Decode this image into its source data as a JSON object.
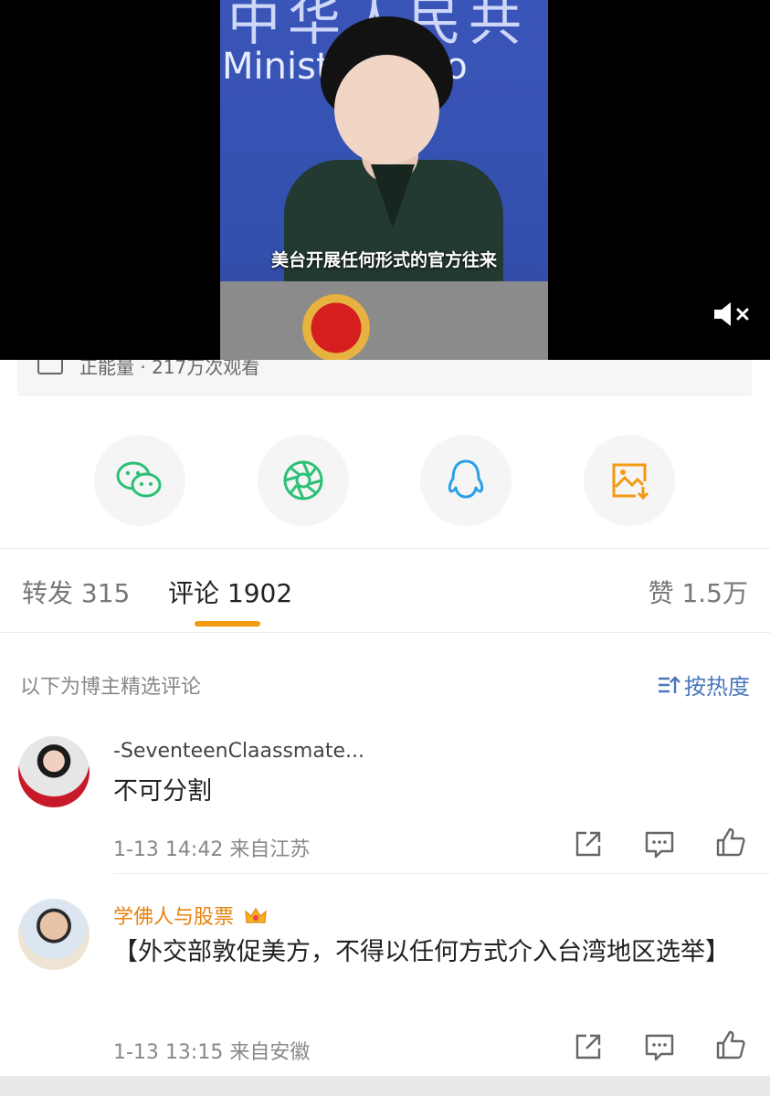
{
  "video": {
    "subtitle": "美台开展任何形式的官方往来",
    "background_text_cn": "中华人民共",
    "background_text_en": "Ministry of Fo",
    "mute_icon": "volume-muted-icon"
  },
  "card": {
    "text": "正能量 · 217万次观看"
  },
  "share": [
    {
      "name": "wechat-icon",
      "color": "#2cbf76"
    },
    {
      "name": "moments-icon",
      "color": "#2cbf76"
    },
    {
      "name": "qq-icon",
      "color": "#2a9fe6"
    },
    {
      "name": "save-image-icon",
      "color": "#f39a12"
    }
  ],
  "tabs": {
    "repost": "转发 315",
    "comment": "评论 1902",
    "like": "赞 1.5万"
  },
  "section_label": "以下为博主精选评论",
  "sort_label": "按热度",
  "comments": [
    {
      "user": "-SeventeenClaassmate...",
      "text": "不可分割",
      "meta": "1-13 14:42  来自江苏"
    },
    {
      "user": "学佛人与股票",
      "text": "【外交部敦促美方，不得以任何方式介入台湾地区选举】",
      "meta": "1-13 13:15  来自安徽"
    }
  ],
  "colors": {
    "accent": "#f39a12",
    "link": "#4b77bd",
    "vip_name": "#e8830e"
  }
}
